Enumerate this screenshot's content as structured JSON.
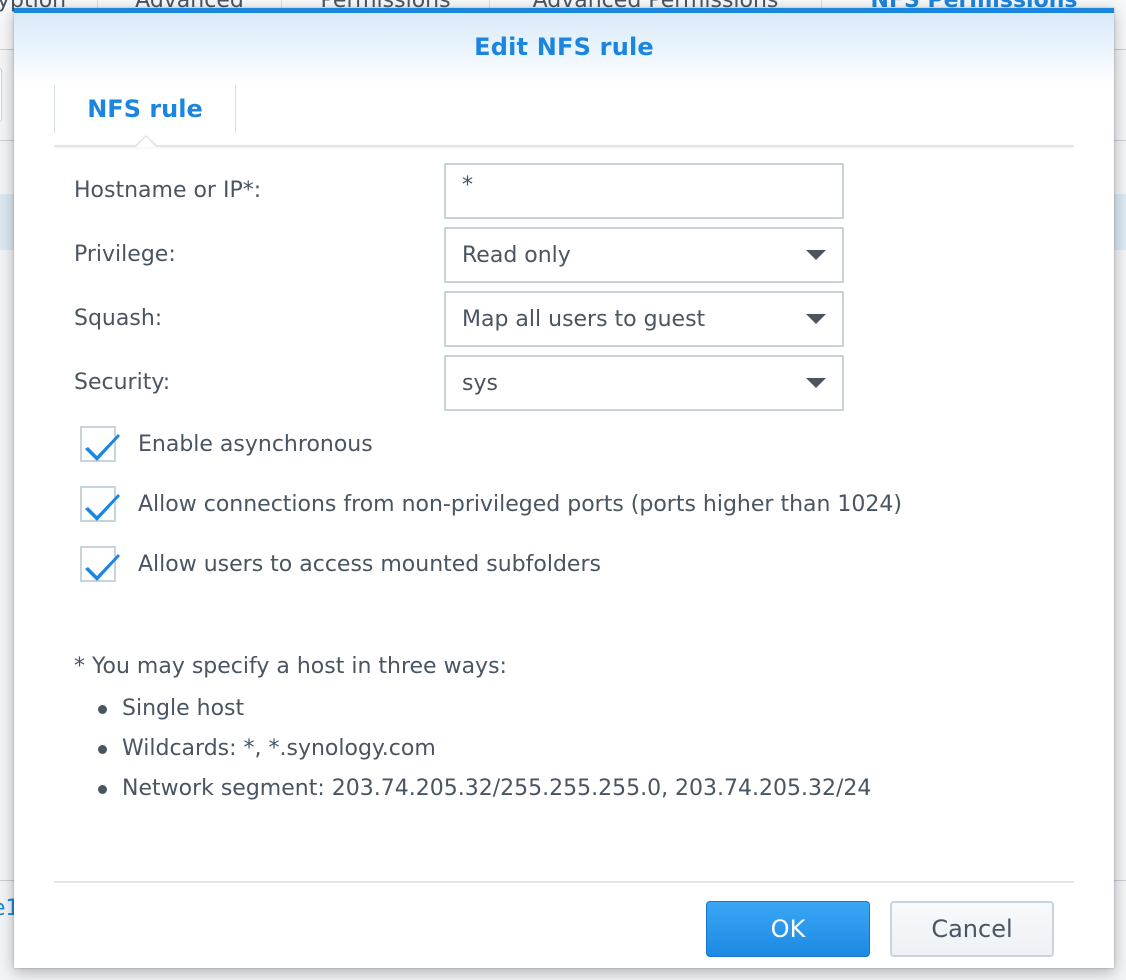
{
  "background": {
    "tabs": [
      {
        "label": "Encryption",
        "active": false
      },
      {
        "label": "Advanced",
        "active": false
      },
      {
        "label": "Permissions",
        "active": false
      },
      {
        "label": "Advanced Permissions",
        "active": false
      },
      {
        "label": "NFS Permissions",
        "active": true
      }
    ],
    "partial_link": "e1"
  },
  "dialog": {
    "title": "Edit NFS rule",
    "tabs": [
      {
        "label": "NFS rule",
        "active": true
      }
    ],
    "fields": {
      "hostname": {
        "label": "Hostname or IP*:",
        "value": "*"
      },
      "privilege": {
        "label": "Privilege:",
        "value": "Read only"
      },
      "squash": {
        "label": "Squash:",
        "value": "Map all users to guest"
      },
      "security": {
        "label": "Security:",
        "value": "sys"
      }
    },
    "checkboxes": [
      {
        "label": "Enable asynchronous",
        "checked": true
      },
      {
        "label": "Allow connections from non-privileged ports (ports higher than 1024)",
        "checked": true
      },
      {
        "label": "Allow users to access mounted subfolders",
        "checked": true
      }
    ],
    "help": {
      "title": "* You may specify a host in three ways:",
      "items": [
        "Single host",
        "Wildcards: *, *.synology.com",
        "Network segment: 203.74.205.32/255.255.255.0, 203.74.205.32/24"
      ]
    },
    "buttons": {
      "ok": "OK",
      "cancel": "Cancel"
    }
  },
  "colors": {
    "accent": "#1a86df",
    "text": "#4a5562",
    "border": "#c9d3de"
  },
  "icons": {
    "checkbox_check": "check-icon",
    "dropdown": "caret-down-icon"
  }
}
